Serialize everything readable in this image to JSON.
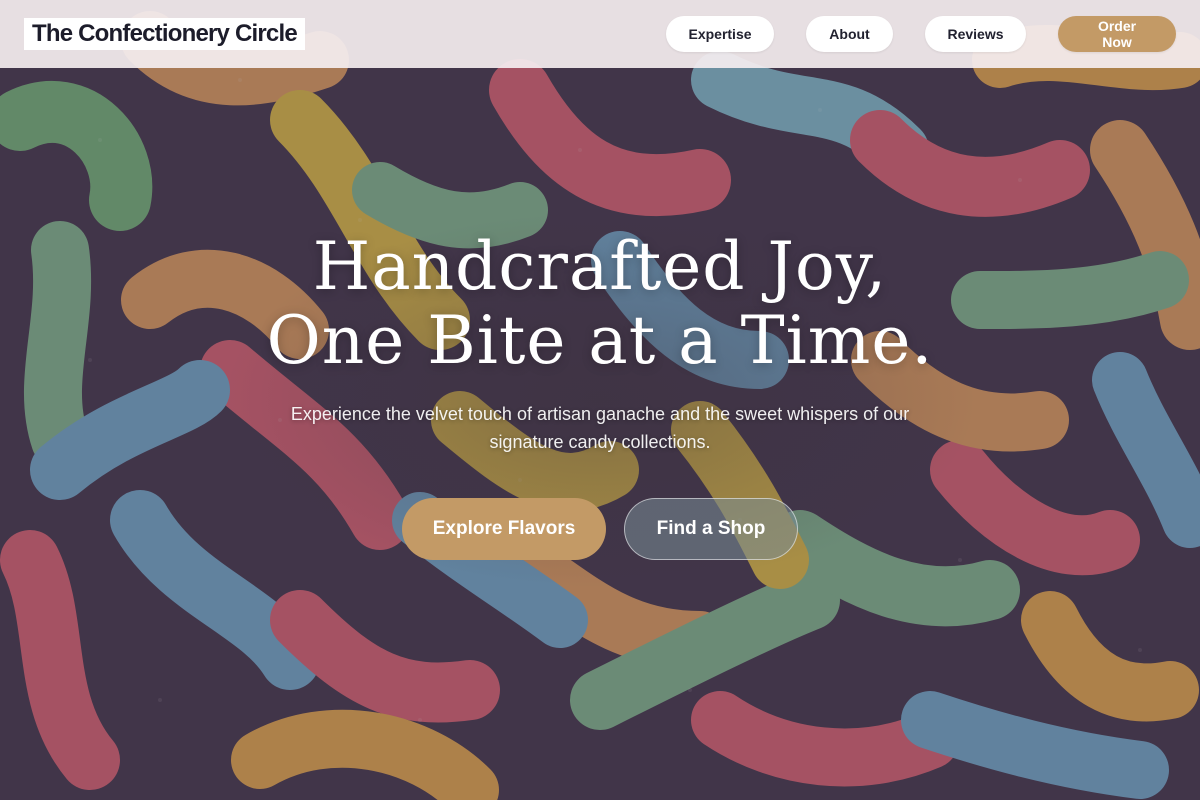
{
  "header": {
    "brand": "The Confectionery Circle",
    "nav": {
      "expertise": "Expertise",
      "about": "About",
      "reviews": "Reviews",
      "order": "Order Now"
    }
  },
  "hero": {
    "headline_line1": "Handcrafted Joy,",
    "headline_line2": "One Bite at a Time.",
    "subtext": "Experience the velvet touch of artisan ganache and the sweet whispers of our signature candy collections.",
    "cta_primary": "Explore Flavors",
    "cta_secondary": "Find a Shop"
  },
  "colors": {
    "accent": "#c39a66",
    "header_bg": "#f5eef0",
    "brand_text": "#1c1c2a"
  },
  "background": {
    "subject": "sour gummy worms"
  }
}
